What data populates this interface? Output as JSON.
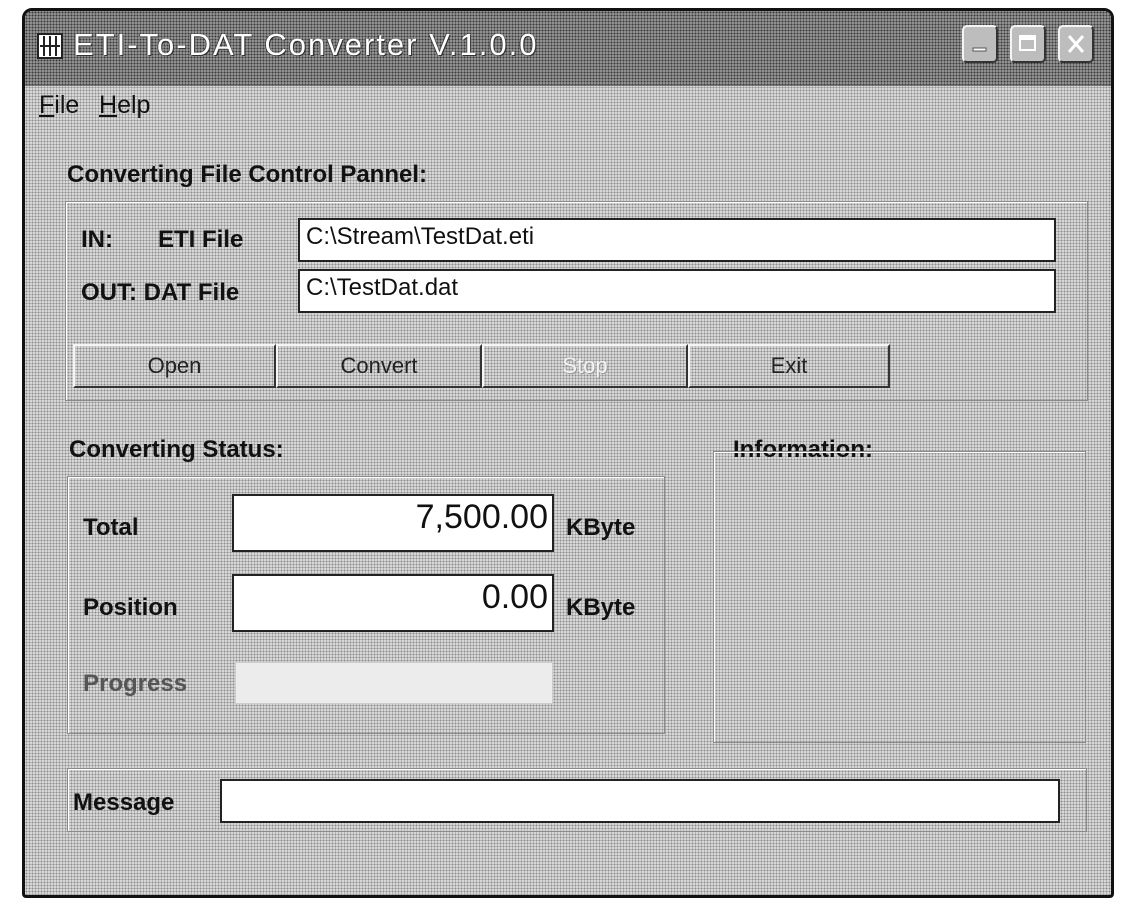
{
  "window": {
    "title": "ETI-To-DAT Converter V.1.0.0",
    "controls": [
      "minimize-icon",
      "maximize-icon",
      "close-icon"
    ]
  },
  "menu": {
    "file": {
      "mnemonic": "F",
      "rest": "ile"
    },
    "help": {
      "mnemonic": "H",
      "rest": "elp"
    }
  },
  "control_panel": {
    "title": "Converting File Control Pannel:",
    "in_label": "IN:",
    "in_file_label": "ETI File",
    "in_value": "C:\\Stream\\TestDat.eti",
    "out_label": "OUT: DAT File",
    "out_value": "C:\\TestDat.dat"
  },
  "buttons": {
    "open": "Open",
    "convert": "Convert",
    "stop": "Stop",
    "exit": "Exit"
  },
  "status": {
    "title": "Converting Status:",
    "total_label": "Total",
    "total_value": "7,500.00",
    "total_unit": "KByte",
    "position_label": "Position",
    "position_value": "0.00",
    "position_unit": "KByte",
    "progress_label": "Progress",
    "progress_fraction": 0
  },
  "information": {
    "title": "Information:"
  },
  "message": {
    "label": "Message",
    "value": ""
  }
}
